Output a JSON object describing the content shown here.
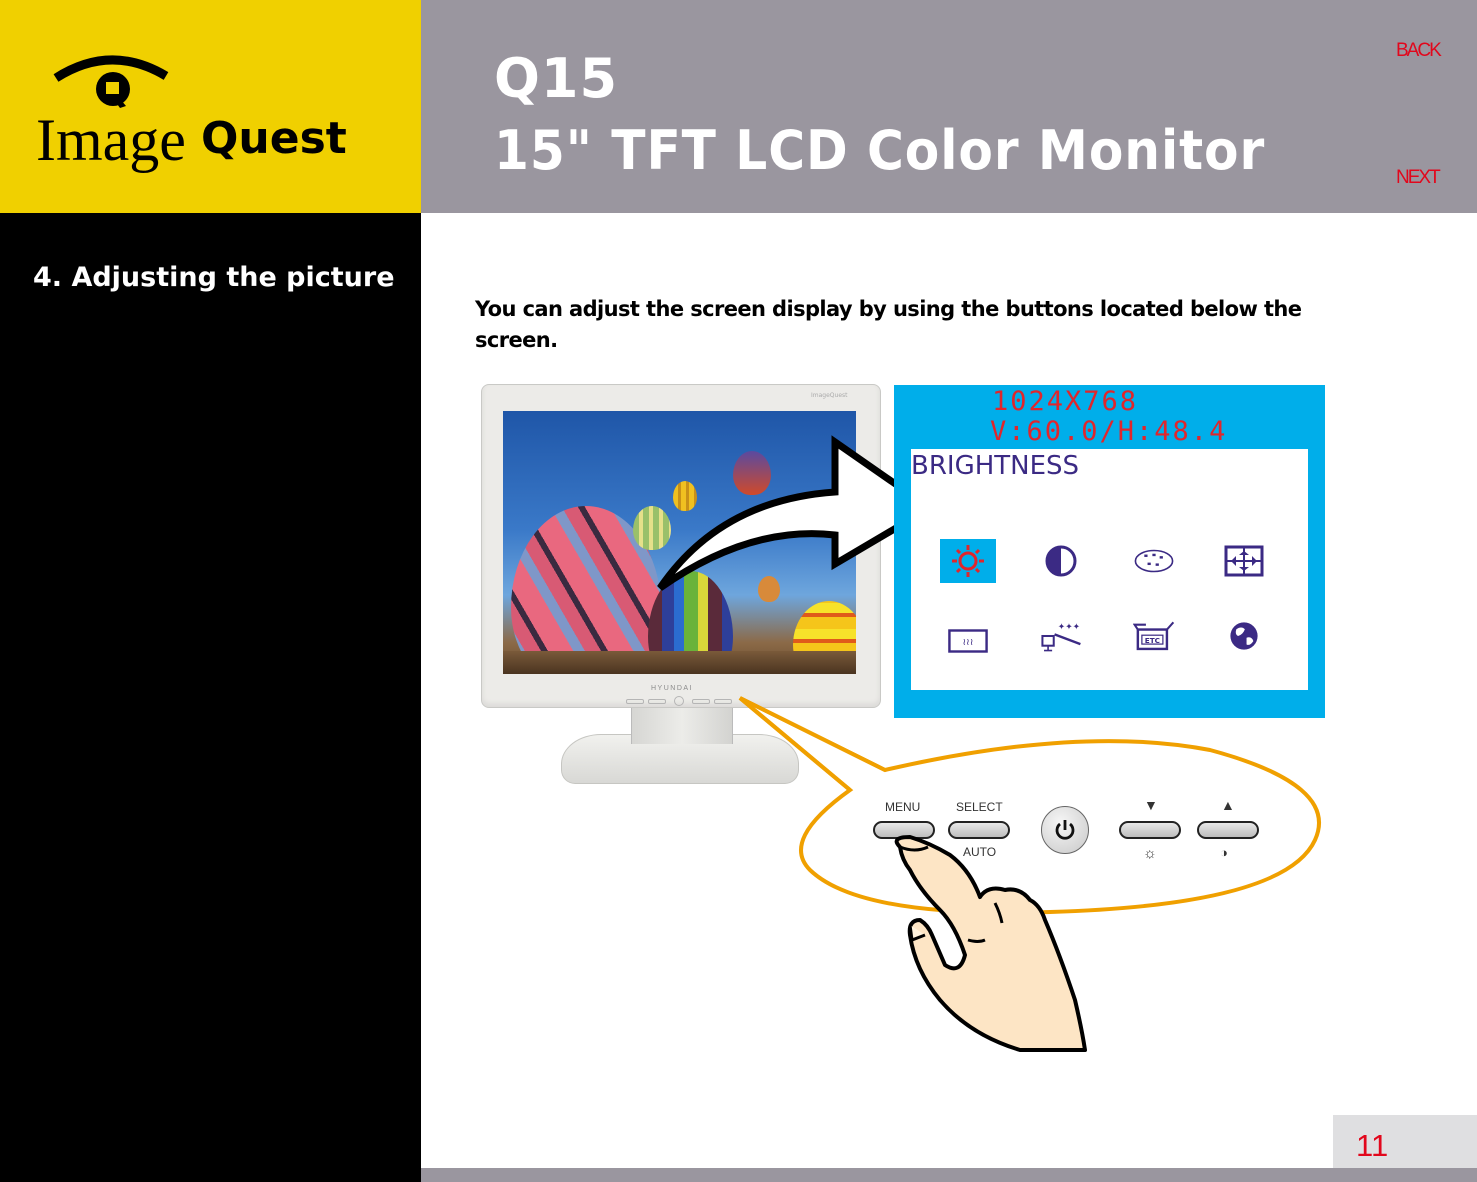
{
  "header": {
    "logo": {
      "prefix": "Image",
      "suffix": "Quest",
      "emblem": "Q"
    },
    "model": "Q15",
    "description": "15\" TFT LCD Color Monitor",
    "nav": {
      "back": "BACK",
      "next": "NEXT"
    }
  },
  "sidebar": {
    "section_title": "4. Adjusting the picture"
  },
  "main": {
    "intro": "You can adjust the screen display by using the buttons located below the screen.",
    "monitor": {
      "brand": "HYUNDAI",
      "mini_logo": "ImageQuest"
    },
    "osd": {
      "resolution": "1024X768",
      "frequency": "V:60.0/H:48.4",
      "menu_title": "BRIGHTNESS",
      "icons": [
        {
          "name": "brightness-icon",
          "selected": true
        },
        {
          "name": "contrast-icon",
          "selected": false
        },
        {
          "name": "color-palette-icon",
          "selected": false
        },
        {
          "name": "position-icon",
          "selected": false
        },
        {
          "name": "phase-icon",
          "selected": false
        },
        {
          "name": "auto-adjust-icon",
          "selected": false
        },
        {
          "name": "etc-icon",
          "selected": false
        },
        {
          "name": "language-globe-icon",
          "selected": false
        }
      ],
      "etc_label": "ETC"
    },
    "button_panel": {
      "menu": "MENU",
      "select": "SELECT",
      "auto": "AUTO",
      "down_symbol": "▼",
      "up_symbol": "▲",
      "brightness_symbol": "☼",
      "contrast_symbol": "◑"
    }
  },
  "footer": {
    "page_number": "11"
  },
  "colors": {
    "logo_yellow": "#f0d000",
    "header_gray": "#9a969f",
    "nav_red": "#e2071c",
    "osd_blue": "#00aeea",
    "osd_text": "#3b2a84",
    "osd_red": "#e0262c",
    "callout_orange": "#f0a000",
    "skin": "#fde5c5"
  }
}
